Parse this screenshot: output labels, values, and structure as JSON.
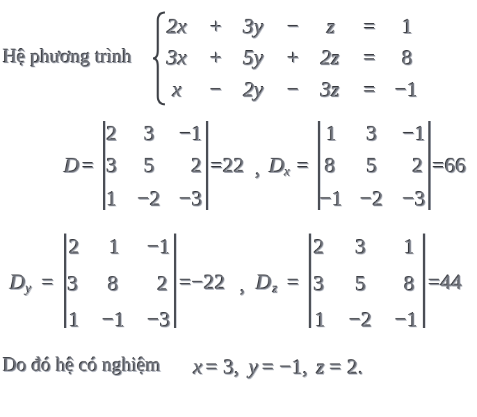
{
  "intro_label": "Hệ phương trình",
  "system": {
    "row1": {
      "a": "2x",
      "op1": "+",
      "b": "3y",
      "op2": "−",
      "c": "z",
      "eq": "=",
      "rhs": "1"
    },
    "row2": {
      "a": "3x",
      "op1": "+",
      "b": "5y",
      "op2": "+",
      "c": "2z",
      "eq": "=",
      "rhs": "8"
    },
    "row3": {
      "a": "x",
      "op1": "−",
      "b": "2y",
      "op2": "−",
      "c": "3z",
      "eq": "=",
      "rhs": "−1"
    }
  },
  "determinants": {
    "D": {
      "name": "D",
      "sub": "",
      "eq": "=",
      "result": "=22",
      "sep": ",",
      "cells": [
        "2",
        "3",
        "−1",
        "3",
        "5",
        "2",
        "1",
        "−2",
        "−3"
      ]
    },
    "Dx": {
      "name": "D",
      "sub": "x",
      "eq": "=",
      "result": "=66",
      "cells": [
        "1",
        "3",
        "−1",
        "8",
        "5",
        "2",
        "−1",
        "−2",
        "−3"
      ]
    },
    "Dy": {
      "name": "D",
      "sub": "y",
      "eq": "=",
      "result": "=−22",
      "sep": ",",
      "cells": [
        "2",
        "1",
        "−1",
        "3",
        "8",
        "2",
        "1",
        "−1",
        "−3"
      ]
    },
    "Dz": {
      "name": "D",
      "sub": "z",
      "eq": "=",
      "result": "=44",
      "cells": [
        "2",
        "3",
        "1",
        "3",
        "5",
        "8",
        "1",
        "−2",
        "−1"
      ]
    }
  },
  "conclusion": {
    "text": "Do đó hệ có nghiệm",
    "x_var": "x",
    "x_val": "= 3,",
    "y_var": "y",
    "y_val": "= −1,",
    "z_var": "z",
    "z_val": "= 2."
  }
}
